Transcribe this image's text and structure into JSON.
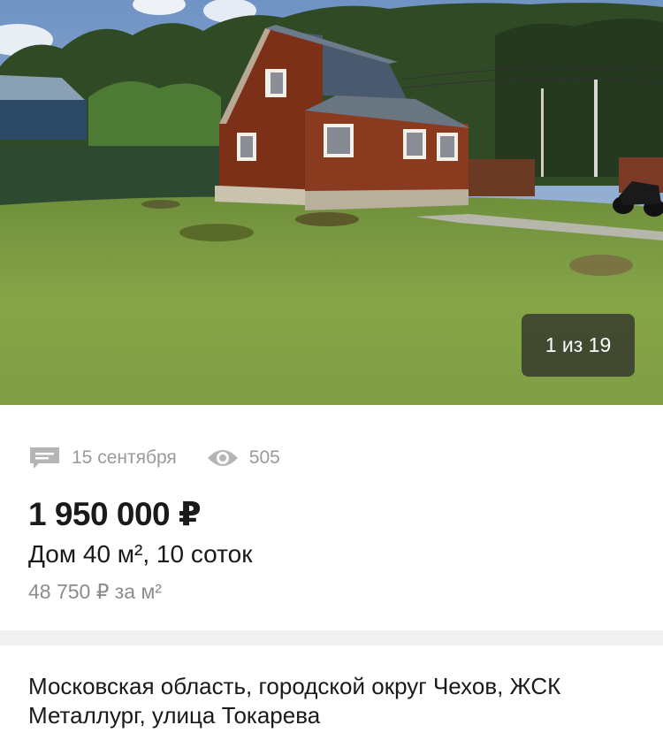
{
  "gallery": {
    "counter_text": "1 из 19",
    "current": 1,
    "total": 19
  },
  "meta": {
    "comment_icon": "message-icon",
    "date": "15 сентября",
    "views_icon": "eye-icon",
    "views": "505"
  },
  "listing": {
    "price": "1 950 000 ₽",
    "title": "Дом 40 м², 10 соток",
    "price_per_m": "48 750 ₽ за м²",
    "address": "Московская область, городской округ Чехов, ЖСК Металлург, улица Токарева"
  },
  "colors": {
    "meta_gray": "#9a9a9a",
    "divider": "#f0f0f0",
    "text": "#1a1a1a"
  }
}
